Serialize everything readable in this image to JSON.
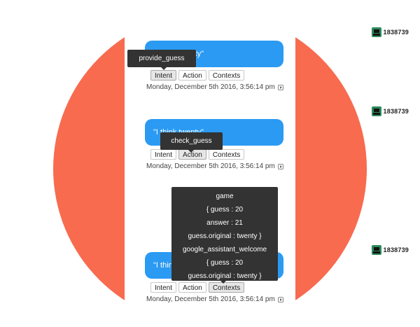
{
  "colors": {
    "backdrop": "#f86b4f",
    "bubble": "#2b9af3",
    "tooltip": "#333333"
  },
  "user": {
    "id": "1838739",
    "icon": "android-bot-icon"
  },
  "timestamp": "Monday, December 5th 2016, 3:56:14 pm",
  "buttons": {
    "intent": "Intent",
    "action": "Action",
    "contexts": "Contexts"
  },
  "messages": [
    {
      "text": "\"I think twenty\"",
      "active": "intent",
      "tooltip": [
        "provide_guess"
      ]
    },
    {
      "text": "\"I think twenty\"",
      "active": "action",
      "tooltip": [
        "check_guess"
      ]
    },
    {
      "text": "\"I think twenty\"",
      "active": "contexts",
      "tooltip": [
        "game",
        "{ guess : 20",
        "answer : 21",
        "guess.original : twenty }",
        "google_assistant_welcome",
        "{ guess : 20",
        "guess.original : twenty }"
      ]
    }
  ]
}
